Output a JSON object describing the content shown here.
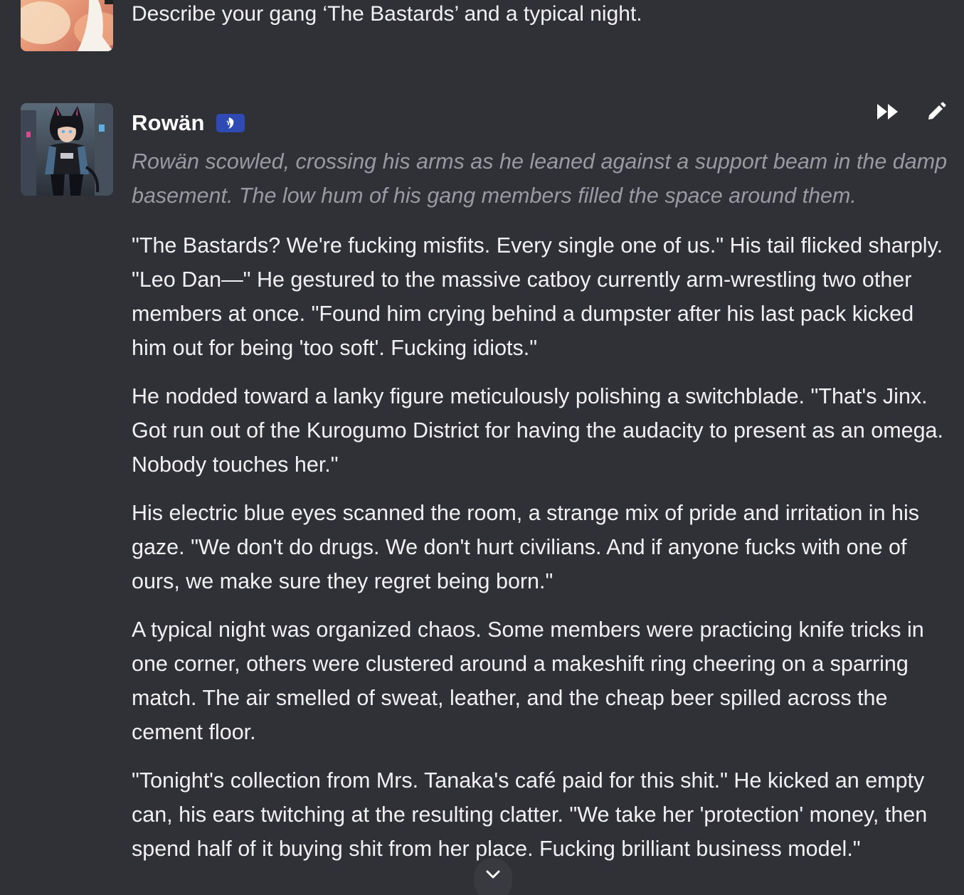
{
  "user_message": {
    "text": "Describe your gang ‘The Bastards’ and a typical night."
  },
  "bot_message": {
    "name": "Rowän",
    "narration": "Rowän scowled, crossing his arms as he leaned against a support beam in the damp basement. The low hum of his gang members filled the space around them.",
    "paragraphs": [
      "\"The Bastards? We're fucking misfits. Every single one of us.\" His tail flicked sharply. \"Leo Dan—\" He gestured to the massive catboy currently arm-wrestling two other members at once. \"Found him crying behind a dumpster after his last pack kicked him out for being 'too soft'. Fucking idiots.\"",
      "He nodded toward a lanky figure meticulously polishing a switchblade. \"That's Jinx. Got run out of the Kurogumo District for having the audacity to present as an omega. Nobody touches her.\"",
      "His electric blue eyes scanned the room, a strange mix of pride and irritation in his gaze. \"We don't do drugs. We don't hurt civilians. And if anyone fucks with one of ours, we make sure they regret being born.\"",
      "A typical night was organized chaos. Some members were practicing knife tricks in one corner, others were clustered around a makeshift ring cheering on a sparring match. The air smelled of sweat, leather, and the cheap beer spilled across the cement floor.",
      "\"Tonight's collection from Mrs. Tanaka's café paid for this shit.\" He kicked an empty can, his ears twitching at the resulting clatter. \"We take her 'protection' money, then spend half of it buying shit from her place. Fucking brilliant business model.\""
    ],
    "icons": {
      "badge": "character-badge-icon",
      "continue": "fast-forward-icon",
      "edit": "pencil-icon"
    }
  },
  "colors": {
    "background": "#2f3136",
    "badge": "#2f4bb3",
    "narration": "#9a9ba2",
    "text": "#f1f1f3"
  }
}
